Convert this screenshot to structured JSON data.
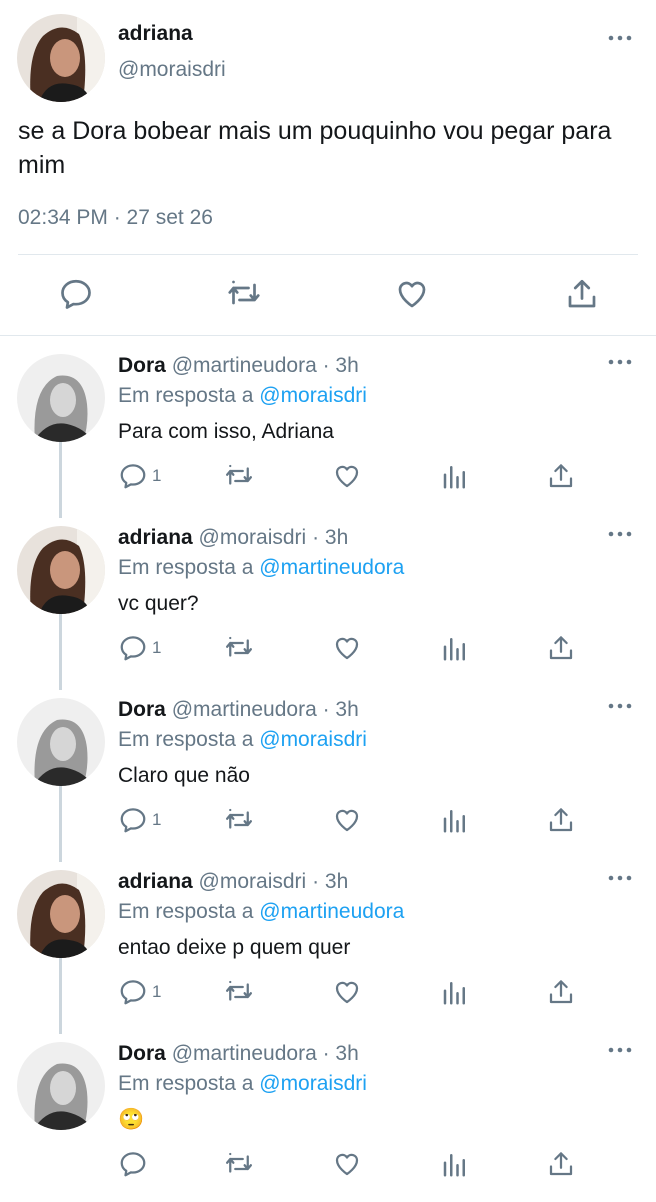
{
  "main_tweet": {
    "name": "adriana",
    "handle": "@moraisdri",
    "text": "se a Dora bobear mais um pouquinho vou pegar para mim",
    "timestamp": "02:34 PM · 27 set 26",
    "icons": {
      "more": "more-dots-icon",
      "reply": "reply-icon",
      "retweet": "retweet-icon",
      "like": "heart-icon",
      "share": "share-icon"
    }
  },
  "replies": [
    {
      "name": "Dora",
      "handle": "@martineudora",
      "time": "· 3h",
      "reply_prefix": "Em resposta a",
      "reply_to": "@moraisdri",
      "text": "Para com isso, Adriana",
      "reply_count": "1"
    },
    {
      "name": "adriana",
      "handle": "@moraisdri",
      "time": "· 3h",
      "reply_prefix": "Em resposta a",
      "reply_to": "@martineudora",
      "text": "vc quer?",
      "reply_count": "1"
    },
    {
      "name": "Dora",
      "handle": "@martineudora",
      "time": "· 3h",
      "reply_prefix": "Em resposta a",
      "reply_to": "@moraisdri",
      "text": "Claro que não",
      "reply_count": "1"
    },
    {
      "name": "adriana",
      "handle": "@moraisdri",
      "time": "· 3h",
      "reply_prefix": "Em resposta a",
      "reply_to": "@martineudora",
      "text": "entao deixe p quem quer",
      "reply_count": "1"
    },
    {
      "name": "Dora",
      "handle": "@martineudora",
      "time": "· 3h",
      "reply_prefix": "Em resposta a",
      "reply_to": "@moraisdri",
      "text": "🙄",
      "reply_count": ""
    }
  ],
  "colors": {
    "text": "#14171a",
    "secondary": "#657786",
    "link": "#1da1f2",
    "divider": "#e1e8ed"
  }
}
